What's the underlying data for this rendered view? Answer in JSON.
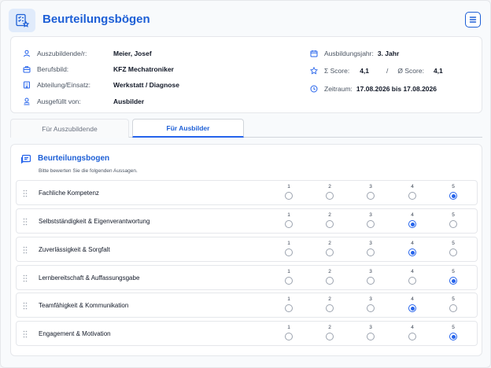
{
  "header": {
    "title": "Beurteilungsbögen"
  },
  "info": {
    "trainee_label": "Auszubildende/r:",
    "trainee_value": "Meier, Josef",
    "job_label": "Berufsbild:",
    "job_value": "KFZ Mechatroniker",
    "dept_label": "Abteilung/Einsatz:",
    "dept_value": "Werkstatt / Diagnose",
    "filled_label": "Ausgefüllt von:",
    "filled_value": "Ausbilder",
    "year_label": "Ausbildungsjahr:",
    "year_value": "3. Jahr",
    "sum_label": "Σ Score:",
    "sum_value": "4,1",
    "sep": "/",
    "avg_label": "Ø Score:",
    "avg_value": "4,1",
    "period_label": "Zeitraum:",
    "period_value": "17.08.2026 bis 17.08.2026"
  },
  "tabs": [
    {
      "label": "Für Auszubildende",
      "active": false
    },
    {
      "label": "Für Ausbilder",
      "active": true
    }
  ],
  "form": {
    "title": "Beurteilungsbogen",
    "subtitle": "Bitte bewerten Sie die folgenden Aussagen.",
    "scale": [
      "1",
      "2",
      "3",
      "4",
      "5"
    ],
    "questions": [
      {
        "label": "Fachliche Kompetenz",
        "selected": 5
      },
      {
        "label": "Selbstständigkeit & Eigenverantwortung",
        "selected": 4
      },
      {
        "label": "Zuverlässigkeit & Sorgfalt",
        "selected": 4
      },
      {
        "label": "Lernbereitschaft & Auffassungsgabe",
        "selected": 5
      },
      {
        "label": "Teamfähigkeit & Kommunikation",
        "selected": 4
      },
      {
        "label": "Engagement & Motivation",
        "selected": 5
      }
    ]
  },
  "colors": {
    "accent": "#1d5fd6",
    "radio_on": "#2563eb"
  },
  "icons": [
    "checklist-star-icon",
    "menu-icon",
    "user-icon",
    "briefcase-icon",
    "building-icon",
    "user-check-icon",
    "calendar-icon",
    "star-icon",
    "clock-icon",
    "message-icon",
    "drag-handle-icon"
  ]
}
